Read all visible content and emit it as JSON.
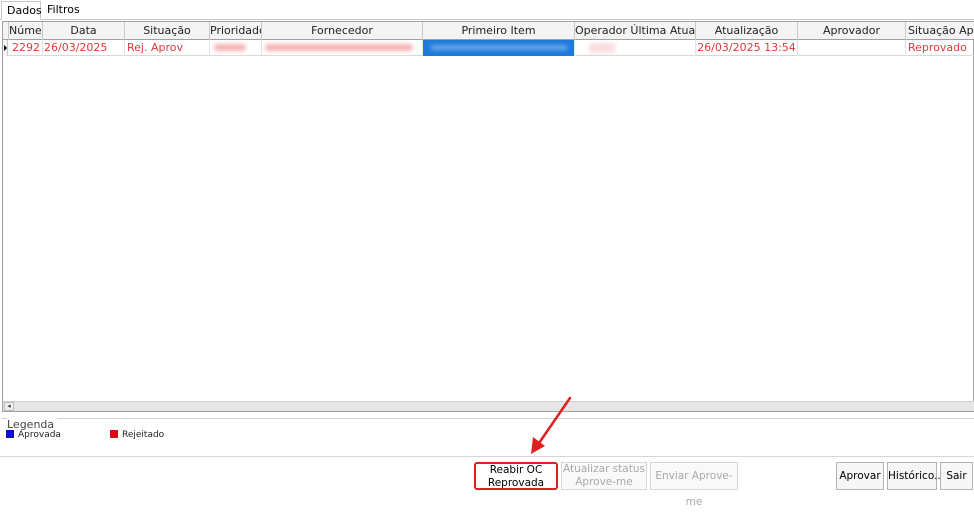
{
  "tabs": {
    "dados": "Dados",
    "filtros": "Filtros"
  },
  "grid": {
    "columns": [
      "Número",
      "Data",
      "Situação",
      "Prioridade",
      "Fornecedor",
      "Primeiro Item",
      "Operador Última Atualização",
      "Atualização",
      "Aprovador",
      "Situação Aprovação"
    ],
    "rows": [
      {
        "numero": "2292",
        "data": "26/03/2025",
        "situacao": "Rej. Aprov",
        "prioridade": "",
        "fornecedor": "",
        "primeiro_item": "",
        "operador": "",
        "atualizacao": "26/03/2025 13:54",
        "aprovador": "",
        "situacao_aprovacao": "Reprovado"
      }
    ]
  },
  "legend": {
    "title": "Legenda",
    "items": [
      {
        "label": "Aprovada",
        "color": "#1010c8"
      },
      {
        "label": "Rejeitado",
        "color": "#d01010"
      }
    ]
  },
  "buttons": {
    "reabrir_line1": "Reabir OC",
    "reabrir_line2": "Reprovada",
    "atualizar_line1": "Atualizar status",
    "atualizar_line2": "Aprove-me",
    "enviar": "Enviar Aprove-me",
    "aprovar": "Aprovar",
    "historico": "Histórico...",
    "sair": "Sair"
  },
  "colors": {
    "rejected_text": "#e03a3a",
    "annotation_red": "#e02020"
  }
}
